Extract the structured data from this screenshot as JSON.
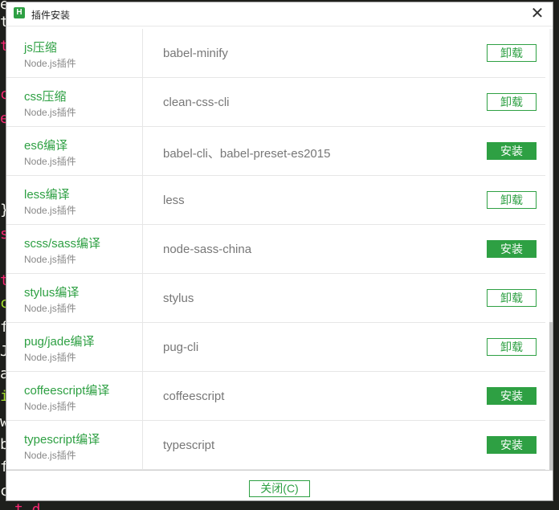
{
  "background_code": {
    "chars": [
      {
        "ch": "e",
        "color": "#f8f8f2"
      },
      {
        "ch": "t",
        "color": "#f8f8f2"
      },
      {
        "ch": "t",
        "color": "#f92672"
      },
      {
        "ch": "c",
        "color": "#f92672"
      },
      {
        "ch": "e",
        "color": "#f92672"
      },
      {
        "ch": "}",
        "color": "#f8f8f2"
      },
      {
        "ch": "s",
        "color": "#f92672"
      },
      {
        "ch": "t",
        "color": "#f92672"
      },
      {
        "ch": "c",
        "color": "#a6e22e"
      },
      {
        "ch": "f",
        "color": "#f8f8f2"
      },
      {
        "ch": "J",
        "color": "#f8f8f2"
      },
      {
        "ch": "a",
        "color": "#f8f8f2"
      },
      {
        "ch": "i",
        "color": "#a6e22e"
      },
      {
        "ch": "w",
        "color": "#f8f8f2"
      },
      {
        "ch": "b",
        "color": "#f8f8f2"
      },
      {
        "ch": "f",
        "color": "#f8f8f2"
      },
      {
        "ch": "c",
        "color": "#f8f8f2"
      }
    ],
    "bottom_fragment": "t d"
  },
  "dialog": {
    "title": "插件安装",
    "app_icon": "H",
    "close_glyph": "✕"
  },
  "plugins": [
    {
      "name": "js压缩",
      "type": "Node.js插件",
      "package": "babel-minify",
      "action": "卸载",
      "state": "installed"
    },
    {
      "name": "css压缩",
      "type": "Node.js插件",
      "package": "clean-css-cli",
      "action": "卸载",
      "state": "installed"
    },
    {
      "name": "es6编译",
      "type": "Node.js插件",
      "package": "babel-cli、babel-preset-es2015",
      "action": "安装",
      "state": "not-installed"
    },
    {
      "name": "less编译",
      "type": "Node.js插件",
      "package": "less",
      "action": "卸载",
      "state": "installed"
    },
    {
      "name": "scss/sass编译",
      "type": "Node.js插件",
      "package": "node-sass-china",
      "action": "安装",
      "state": "not-installed"
    },
    {
      "name": "stylus编译",
      "type": "Node.js插件",
      "package": "stylus",
      "action": "卸载",
      "state": "installed"
    },
    {
      "name": "pug/jade编译",
      "type": "Node.js插件",
      "package": "pug-cli",
      "action": "卸载",
      "state": "installed"
    },
    {
      "name": "coffeescript编译",
      "type": "Node.js插件",
      "package": "coffeescript",
      "action": "安装",
      "state": "not-installed"
    },
    {
      "name": "typescript编译",
      "type": "Node.js插件",
      "package": "typescript",
      "action": "安装",
      "state": "not-installed"
    }
  ],
  "footer": {
    "close_label": "关闭(C)"
  },
  "colors": {
    "accent": "#2ea043",
    "editor_bg": "#1e1f1c"
  }
}
